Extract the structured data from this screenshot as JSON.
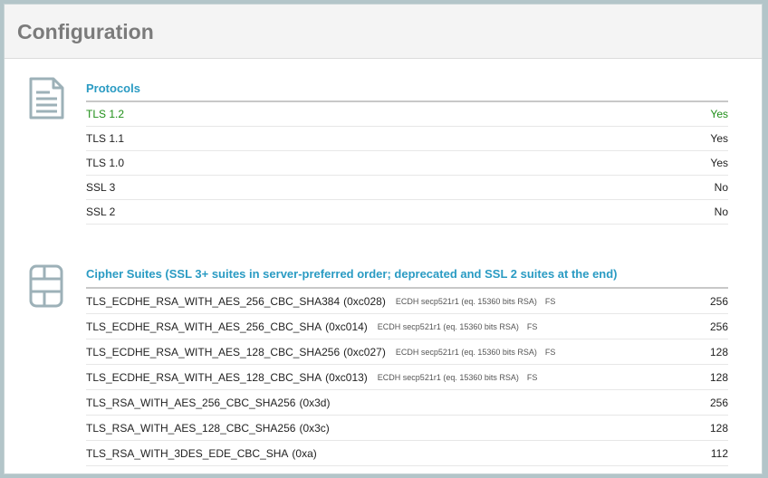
{
  "page": {
    "title": "Configuration"
  },
  "protocols": {
    "icon": "document-icon",
    "title": "Protocols",
    "rows": [
      {
        "name": "TLS 1.2",
        "value": "Yes",
        "highlight": true
      },
      {
        "name": "TLS 1.1",
        "value": "Yes",
        "highlight": false
      },
      {
        "name": "TLS 1.0",
        "value": "Yes",
        "highlight": false
      },
      {
        "name": "SSL 3",
        "value": "No",
        "highlight": false
      },
      {
        "name": "SSL 2",
        "value": "No",
        "highlight": false
      }
    ]
  },
  "cipher_suites": {
    "icon": "list-table-icon",
    "title": "Cipher Suites (SSL 3+ suites in server-preferred order; deprecated and SSL 2 suites at the end)",
    "rows": [
      {
        "name": "TLS_ECDHE_RSA_WITH_AES_256_CBC_SHA384",
        "code": "(0xc028)",
        "kx": "ECDH secp521r1 (eq. 15360 bits RSA)",
        "fs": "FS",
        "bits": "256"
      },
      {
        "name": "TLS_ECDHE_RSA_WITH_AES_256_CBC_SHA",
        "code": "(0xc014)",
        "kx": "ECDH secp521r1 (eq. 15360 bits RSA)",
        "fs": "FS",
        "bits": "256"
      },
      {
        "name": "TLS_ECDHE_RSA_WITH_AES_128_CBC_SHA256",
        "code": "(0xc027)",
        "kx": "ECDH secp521r1 (eq. 15360 bits RSA)",
        "fs": "FS",
        "bits": "128"
      },
      {
        "name": "TLS_ECDHE_RSA_WITH_AES_128_CBC_SHA",
        "code": "(0xc013)",
        "kx": "ECDH secp521r1 (eq. 15360 bits RSA)",
        "fs": "FS",
        "bits": "128"
      },
      {
        "name": "TLS_RSA_WITH_AES_256_CBC_SHA256",
        "code": "(0x3d)",
        "kx": "",
        "fs": "",
        "bits": "256"
      },
      {
        "name": "TLS_RSA_WITH_AES_128_CBC_SHA256",
        "code": "(0x3c)",
        "kx": "",
        "fs": "",
        "bits": "128"
      },
      {
        "name": "TLS_RSA_WITH_3DES_EDE_CBC_SHA",
        "code": "(0xa)",
        "kx": "",
        "fs": "",
        "bits": "112"
      }
    ]
  },
  "colors": {
    "accent": "#2a9bc3",
    "enabled": "#1f8f18",
    "heading": "#7b7b7b",
    "icon": "#9db1b8"
  }
}
